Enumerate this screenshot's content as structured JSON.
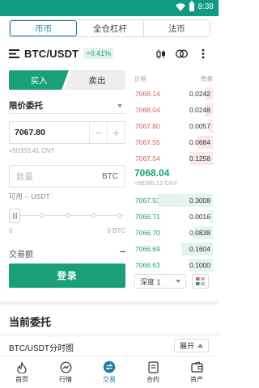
{
  "status_bar": {
    "time": "8:38"
  },
  "tabs": [
    {
      "label": "币币",
      "active": true
    },
    {
      "label": "全仓杠杆",
      "active": false
    },
    {
      "label": "法币",
      "active": false
    }
  ],
  "pair": {
    "symbol": "BTC/USDT",
    "change": "+0.41%"
  },
  "trade": {
    "buy_label": "买入",
    "sell_label": "卖出",
    "order_type": "限价委托",
    "price_value": "7067.80",
    "price_cny": "≈50393.41 CNY",
    "amount_placeholder": "数量",
    "amount_unit": "BTC",
    "available": "可用 -- USDT",
    "slider_min": "0",
    "slider_max": "0 BTC",
    "total_label": "交易额",
    "total_value": "--",
    "login_label": "登录"
  },
  "orderbook": {
    "header_price": "价格",
    "header_qty": "数量",
    "asks": [
      {
        "price": "7068.14",
        "qty": "0.0242",
        "depth": 0.1
      },
      {
        "price": "7068.04",
        "qty": "0.0248",
        "depth": 0.1
      },
      {
        "price": "7067.80",
        "qty": "0.0057",
        "depth": 0.05
      },
      {
        "price": "7067.55",
        "qty": "0.0684",
        "depth": 0.2
      },
      {
        "price": "7067.54",
        "qty": "0.1258",
        "depth": 0.3
      }
    ],
    "last_price": "7068.04",
    "last_price_cny": "≈50395.12 CNY",
    "bids": [
      {
        "price": "7067.53",
        "qty": "0.3008",
        "depth": 0.7
      },
      {
        "price": "7066.71",
        "qty": "0.0016",
        "depth": 0.04
      },
      {
        "price": "7066.70",
        "qty": "0.0838",
        "depth": 0.25
      },
      {
        "price": "7066.69",
        "qty": "0.1604",
        "depth": 0.4
      },
      {
        "price": "7066.63",
        "qty": "0.1000",
        "depth": 0.3
      }
    ],
    "depth_label": "深度 1"
  },
  "open_orders_title": "当前委托",
  "chart_bar": {
    "title": "BTC/USDT分时图",
    "expand_label": "展开"
  },
  "bottom_nav": [
    {
      "label": "首页",
      "icon": "home-icon",
      "active": false
    },
    {
      "label": "行情",
      "icon": "market-icon",
      "active": false
    },
    {
      "label": "交易",
      "icon": "trade-icon",
      "active": true
    },
    {
      "label": "合约",
      "icon": "contract-icon",
      "active": false
    },
    {
      "label": "资产",
      "icon": "asset-icon",
      "active": false
    }
  ],
  "colors": {
    "brand_green": "#1aa079",
    "ask_red": "#e05b5b",
    "active_blue": "#1a7aa8",
    "status_bar": "#0f9a82"
  }
}
